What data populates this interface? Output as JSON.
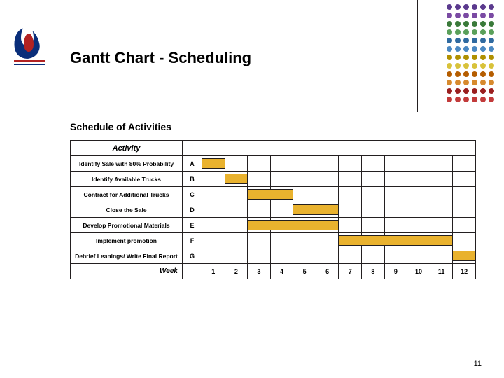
{
  "title": "Gantt Chart - Scheduling",
  "subtitle": "Schedule of Activities",
  "page_number": "11",
  "table": {
    "activity_header": "Activity",
    "week_label": "Week",
    "weeks": [
      "1",
      "2",
      "3",
      "4",
      "5",
      "6",
      "7",
      "8",
      "9",
      "10",
      "11",
      "12"
    ]
  },
  "decor_dot_colors": [
    [
      "#5b3a8e",
      "#5b3a8e",
      "#5b3a8e",
      "#5b3a8e",
      "#5b3a8e",
      "#5b3a8e"
    ],
    [
      "#7a4aa3",
      "#7a4aa3",
      "#7a4aa3",
      "#7a4aa3",
      "#7a4aa3",
      "#7a4aa3"
    ],
    [
      "#3a7a3a",
      "#3a7a3a",
      "#3a7a3a",
      "#3a7a3a",
      "#3a7a3a",
      "#3a7a3a"
    ],
    [
      "#5aa05a",
      "#5aa05a",
      "#5aa05a",
      "#5aa05a",
      "#5aa05a",
      "#5aa05a"
    ],
    [
      "#2f6aa0",
      "#2f6aa0",
      "#2f6aa0",
      "#2f6aa0",
      "#2f6aa0",
      "#2f6aa0"
    ],
    [
      "#4a88c2",
      "#4a88c2",
      "#4a88c2",
      "#4a88c2",
      "#4a88c2",
      "#4a88c2"
    ],
    [
      "#b09000",
      "#b09000",
      "#b09000",
      "#b09000",
      "#b09000",
      "#b09000"
    ],
    [
      "#d8c23a",
      "#d8c23a",
      "#d8c23a",
      "#d8c23a",
      "#d8c23a",
      "#d8c23a"
    ],
    [
      "#b55d00",
      "#b55d00",
      "#b55d00",
      "#b55d00",
      "#b55d00",
      "#b55d00"
    ],
    [
      "#d78a2e",
      "#d78a2e",
      "#d78a2e",
      "#d78a2e",
      "#d78a2e",
      "#d78a2e"
    ],
    [
      "#9a1f1f",
      "#9a1f1f",
      "#9a1f1f",
      "#9a1f1f",
      "#9a1f1f",
      "#9a1f1f"
    ],
    [
      "#c23a3a",
      "#c23a3a",
      "#c23a3a",
      "#c23a3a",
      "#c23a3a",
      "#c23a3a"
    ]
  ],
  "chart_data": {
    "type": "bar",
    "title": "Schedule of Activities",
    "xlabel": "Week",
    "ylabel": "Activity",
    "x_categories": [
      1,
      2,
      3,
      4,
      5,
      6,
      7,
      8,
      9,
      10,
      11,
      12
    ],
    "xlim": [
      1,
      12
    ],
    "bar_color": "#e9b22e",
    "series": [
      {
        "code": "A",
        "name": "Identify Sale with 80% Probability",
        "start": 1,
        "end": 2
      },
      {
        "code": "B",
        "name": "Identify Available Trucks",
        "start": 2,
        "end": 3
      },
      {
        "code": "C",
        "name": "Contract for Additional Trucks",
        "start": 3,
        "end": 5
      },
      {
        "code": "D",
        "name": "Close the Sale",
        "start": 5,
        "end": 7
      },
      {
        "code": "E",
        "name": "Develop Promotional Materials",
        "start": 3,
        "end": 7
      },
      {
        "code": "F",
        "name": "Implement promotion",
        "start": 7,
        "end": 12
      },
      {
        "code": "G",
        "name": "Debrief Leanings/ Write Final Report",
        "start": 12,
        "end": 13
      }
    ]
  }
}
